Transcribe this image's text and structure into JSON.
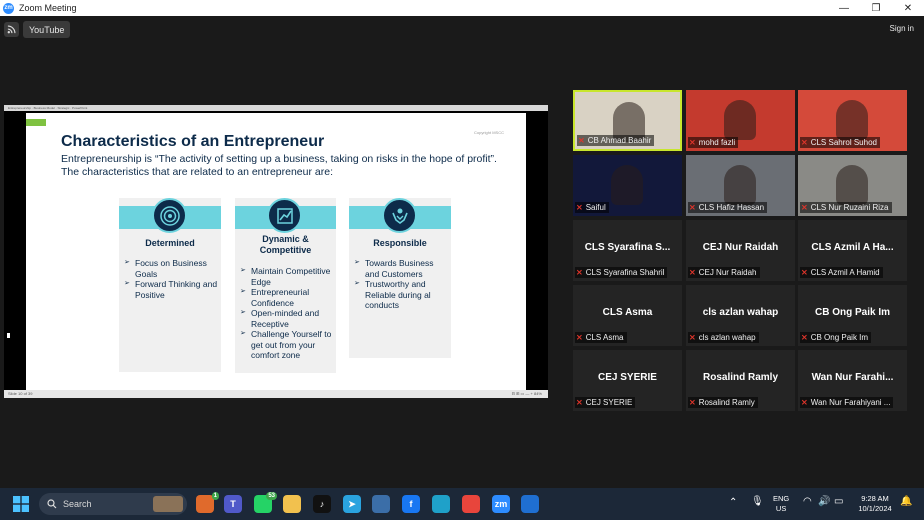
{
  "window": {
    "title": "Zoom Meeting",
    "logo_text": "zm"
  },
  "toolbar": {
    "youtube_label": "YouTube",
    "sign_in_label": "Sign in"
  },
  "share": {
    "top_bar_text": "Entrepreneurship · Business Model · Strategic · PowerPoint",
    "footer_left": "Slide 10 of 39",
    "footer_right": "⊟ ⊞ ▭ — + 84%",
    "slide": {
      "title": "Characteristics of an Entrepreneur",
      "intro": "Entrepreneurship is “The activity of setting up a business, taking on risks in the hope of profit”. The characteristics that are related to an entrepreneur are:",
      "university_mark": "Copyright MSCC",
      "cards": [
        {
          "icon": "target-icon",
          "heading": "Determined",
          "points": [
            "Focus on Business Goals",
            "Forward Thinking and Positive"
          ]
        },
        {
          "icon": "chart-icon",
          "heading": "Dynamic & Competitive",
          "points": [
            "Maintain Competitive Edge",
            "Entrepreneurial Confidence",
            "Open-minded and Receptive",
            "Challenge Yourself to get out from your comfort zone"
          ]
        },
        {
          "icon": "hands-icon",
          "heading": "Responsible",
          "points": [
            "Towards Business and Customers",
            "Trustworthy and Reliable during al conducts"
          ]
        }
      ]
    }
  },
  "participants": [
    {
      "label": "CB Ahmad Baahir",
      "big": "",
      "video": true,
      "bg": "#d9d2c4",
      "active": true
    },
    {
      "label": "mohd fazli",
      "big": "",
      "video": true,
      "bg": "#c43a2e"
    },
    {
      "label": "CLS Sahrol Suhod",
      "big": "",
      "video": true,
      "bg": "#d44a3a"
    },
    {
      "label": "Saiful",
      "big": "",
      "video": true,
      "bg": "#12183a"
    },
    {
      "label": "CLS Hafiz Hassan",
      "big": "",
      "video": true,
      "bg": "#6a6e74"
    },
    {
      "label": "CLS Nur Ruzaini Riza",
      "big": "",
      "video": true,
      "bg": "#8a8a86"
    },
    {
      "label": "CLS Syarafina Shahril",
      "big": "CLS Syarafina S..."
    },
    {
      "label": "CEJ Nur Raidah",
      "big": "CEJ Nur Raidah"
    },
    {
      "label": "CLS Azmil A Hamid",
      "big": "CLS Azmil A Ha..."
    },
    {
      "label": "CLS Asma",
      "big": "CLS Asma"
    },
    {
      "label": "cls azlan wahap",
      "big": "cls azlan wahap"
    },
    {
      "label": "CB Ong Paik Im",
      "big": "CB Ong Paik Im"
    },
    {
      "label": "CEJ SYERIE",
      "big": "CEJ SYERIE"
    },
    {
      "label": "Rosalind Ramly",
      "big": "Rosalind Ramly"
    },
    {
      "label": "Wan Nur Farahiyani ...",
      "big": "Wan Nur Farahi..."
    }
  ],
  "taskbar": {
    "search_placeholder": "Search",
    "apps": [
      {
        "name": "edge-copilot-icon",
        "color": "#e06a2c",
        "badge": "1"
      },
      {
        "name": "teams-icon",
        "color": "#5059c9",
        "glyph": "T"
      },
      {
        "name": "whatsapp-icon",
        "color": "#25d366",
        "badge": "53"
      },
      {
        "name": "file-explorer-icon",
        "color": "#f2c14e"
      },
      {
        "name": "tiktok-icon",
        "color": "#111111",
        "glyph": "♪"
      },
      {
        "name": "telegram-icon",
        "color": "#2aa3df",
        "glyph": "➤"
      },
      {
        "name": "capture-icon",
        "color": "#3b6ea8"
      },
      {
        "name": "facebook-icon",
        "color": "#1877f2",
        "glyph": "f"
      },
      {
        "name": "edge-icon",
        "color": "#1fa1c9"
      },
      {
        "name": "chrome-icon",
        "color": "#e8453c"
      },
      {
        "name": "zoom-icon",
        "color": "#2d8cff",
        "glyph": "zm"
      },
      {
        "name": "snipping-icon",
        "color": "#1f6fd1"
      }
    ],
    "lang": "ENG",
    "region": "US",
    "time": "9:28 AM",
    "date": "10/1/2024"
  }
}
